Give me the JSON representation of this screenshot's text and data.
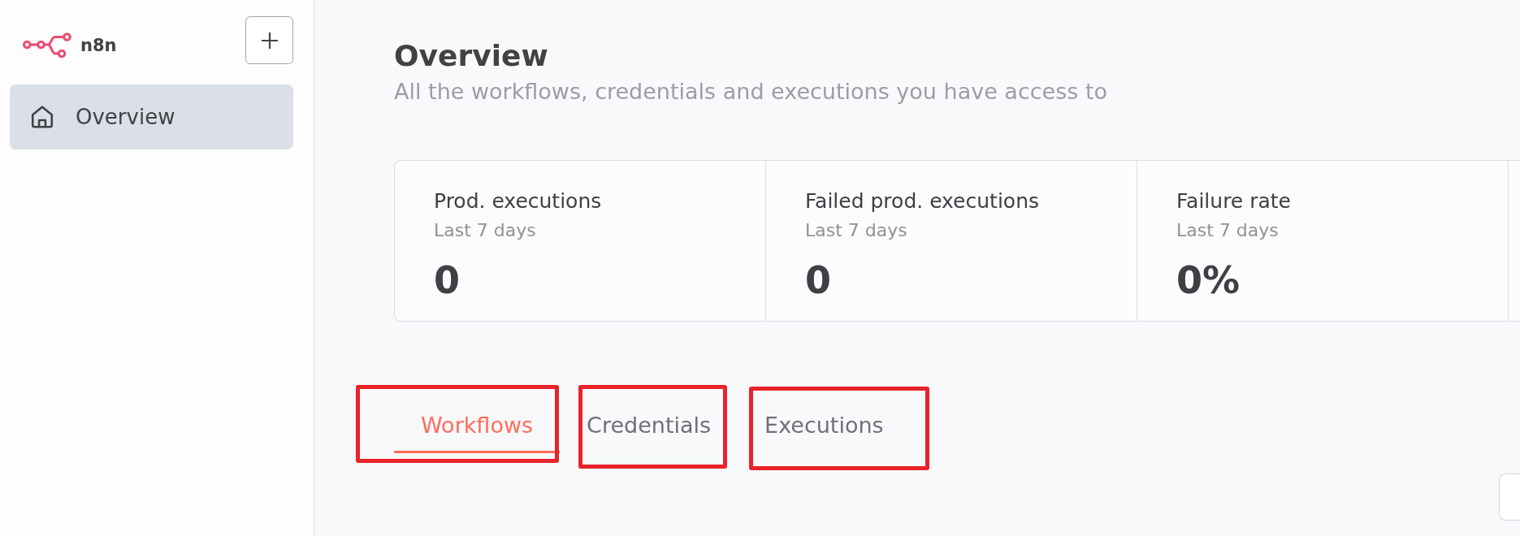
{
  "sidebar": {
    "logo_text": "n8n",
    "items": [
      {
        "label": "Overview",
        "selected": true
      }
    ]
  },
  "page": {
    "title": "Overview",
    "subtitle": "All the workflows, credentials and executions you have access to"
  },
  "stats": [
    {
      "label": "Prod. executions",
      "period": "Last 7 days",
      "value": "0"
    },
    {
      "label": "Failed prod. executions",
      "period": "Last 7 days",
      "value": "0"
    },
    {
      "label": "Failure rate",
      "period": "Last 7 days",
      "value": "0%"
    }
  ],
  "tabs": [
    {
      "label": "Workflows",
      "selected": true,
      "highlighted": true
    },
    {
      "label": "Credentials",
      "selected": false,
      "highlighted": true
    },
    {
      "label": "Executions",
      "selected": false,
      "highlighted": true
    }
  ]
}
